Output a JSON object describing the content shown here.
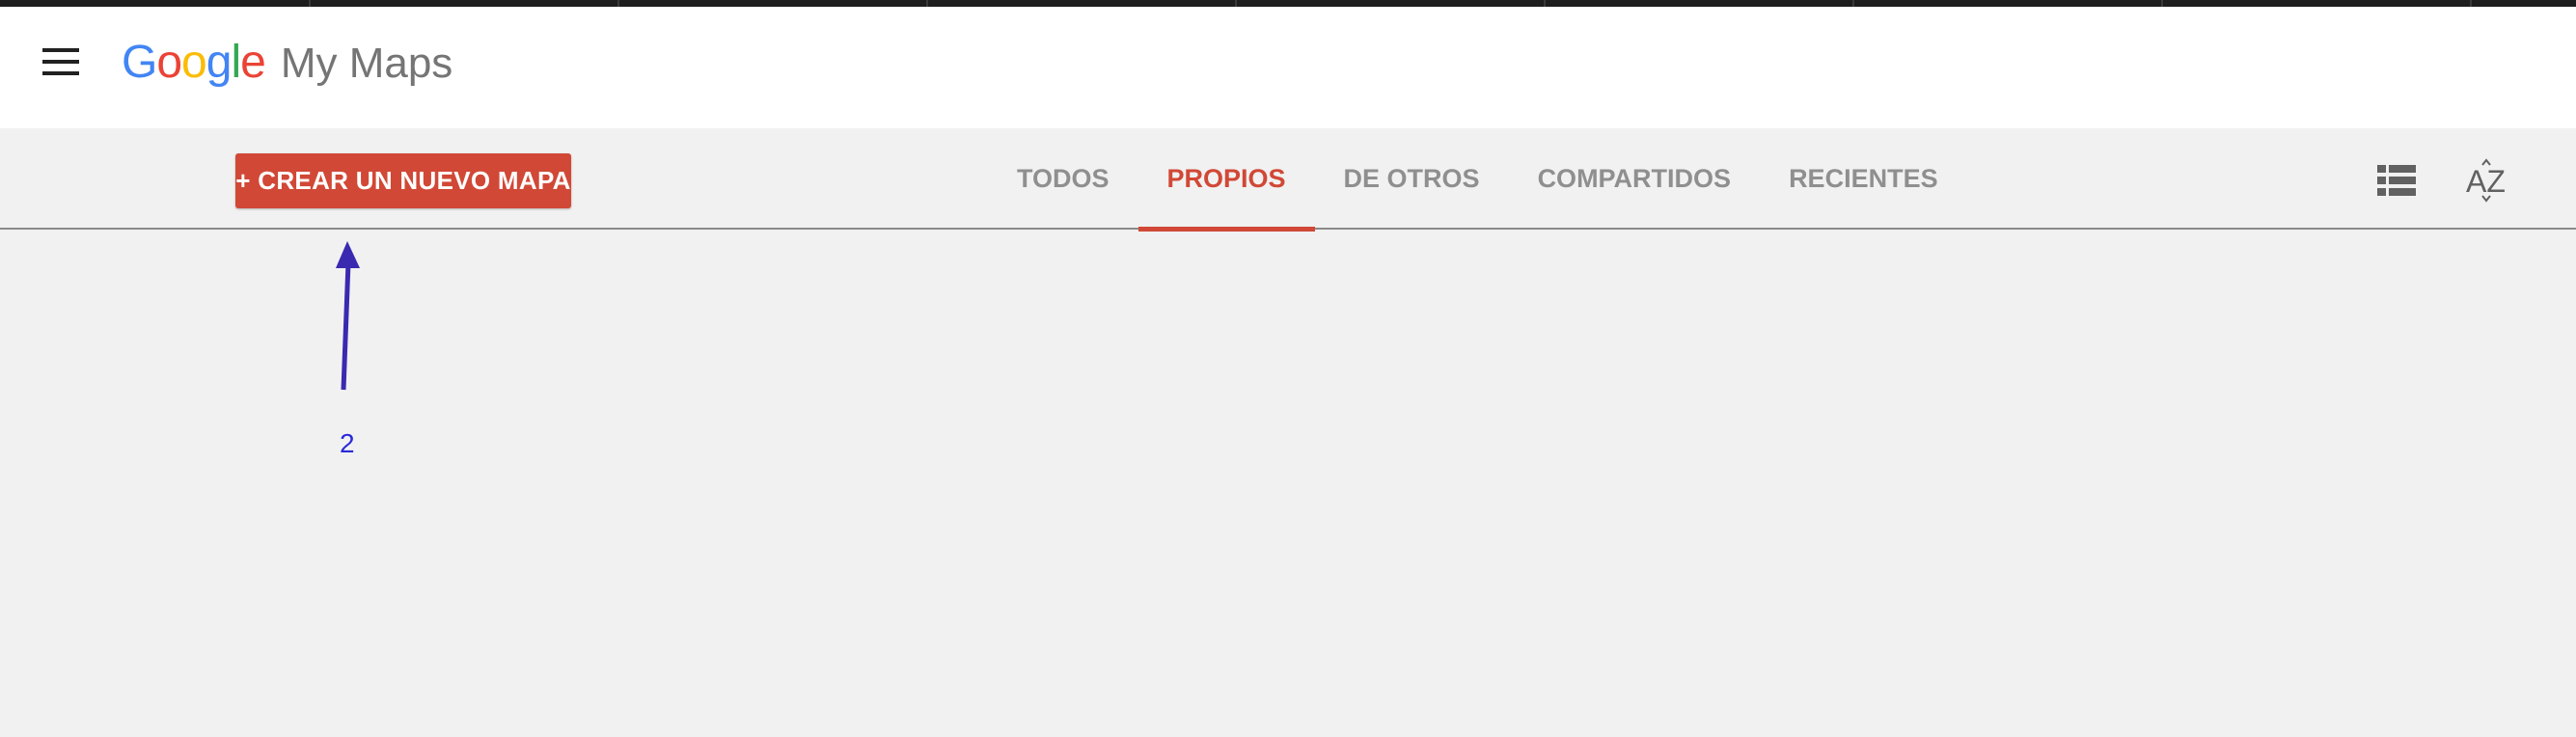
{
  "app": {
    "logo_text": "Google",
    "product_name": "My Maps"
  },
  "toolbar": {
    "create_button_label": "+ CREAR UN NUEVO MAPA",
    "tabs": [
      {
        "label": "TODOS",
        "active": false
      },
      {
        "label": "PROPIOS",
        "active": true
      },
      {
        "label": "DE OTROS",
        "active": false
      },
      {
        "label": "COMPARTIDOS",
        "active": false
      },
      {
        "label": "RECIENTES",
        "active": false
      }
    ],
    "view_icon": "list-view-icon",
    "sort_icon": "sort-az-icon",
    "sort_label": "AZ"
  },
  "annotation": {
    "label": "2"
  },
  "colors": {
    "accent": "#d14836",
    "google_blue": "#4285f4",
    "google_red": "#ea4335",
    "google_yellow": "#fbbc05",
    "google_green": "#34a853",
    "annotation": "#3a2ab0"
  }
}
